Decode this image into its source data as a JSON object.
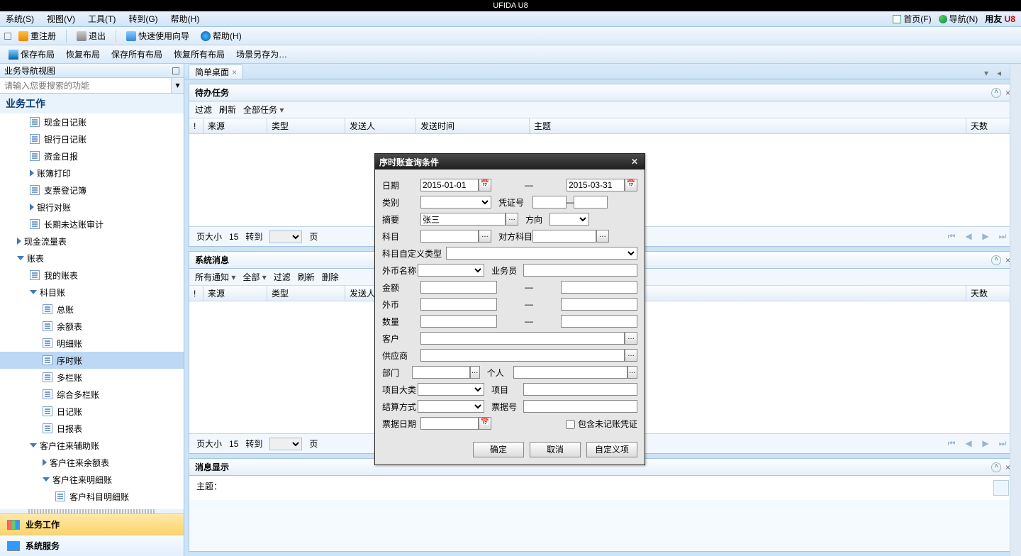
{
  "titlebar": "UFIDA U8",
  "menubar": {
    "items": [
      "系统(S)",
      "视图(V)",
      "工具(T)",
      "转到(G)",
      "帮助(H)"
    ],
    "right": {
      "home": "首页(F)",
      "nav": "导航(N)",
      "brand": "用友",
      "sub": "U8"
    }
  },
  "toolbar1": {
    "register": "重注册",
    "exit": "退出",
    "wizard": "快速使用向导",
    "help": "帮助(H)"
  },
  "toolbar2": {
    "saveLayout": "保存布局",
    "restoreLayout": "恢复布局",
    "saveAll": "保存所有布局",
    "restoreAll": "恢复所有布局",
    "saveScene": "场景另存为…"
  },
  "sidebar": {
    "headTitle": "业务导航视图",
    "searchPlaceholder": "请输入您要搜索的功能",
    "sectionTitle": "业务工作",
    "tree": [
      {
        "lvl": 2,
        "icon": "doc",
        "label": "现金日记账"
      },
      {
        "lvl": 2,
        "icon": "doc",
        "label": "银行日记账"
      },
      {
        "lvl": 2,
        "icon": "doc",
        "label": "资金日报"
      },
      {
        "lvl": 2,
        "icon": "tri-right",
        "label": "账簿打印"
      },
      {
        "lvl": 2,
        "icon": "doc",
        "label": "支票登记簿"
      },
      {
        "lvl": 2,
        "icon": "tri-right",
        "label": "银行对账"
      },
      {
        "lvl": 2,
        "icon": "doc",
        "label": "长期未达账审计"
      },
      {
        "lvl": 1,
        "icon": "tri-right",
        "label": "现金流量表"
      },
      {
        "lvl": 1,
        "icon": "tri-down",
        "label": "账表"
      },
      {
        "lvl": 2,
        "icon": "doc",
        "label": "我的账表"
      },
      {
        "lvl": 2,
        "icon": "tri-down",
        "label": "科目账"
      },
      {
        "lvl": 3,
        "icon": "doc",
        "label": "总账"
      },
      {
        "lvl": 3,
        "icon": "doc",
        "label": "余额表"
      },
      {
        "lvl": 3,
        "icon": "doc",
        "label": "明细账"
      },
      {
        "lvl": 3,
        "icon": "doc",
        "label": "序时账",
        "selected": true
      },
      {
        "lvl": 3,
        "icon": "doc",
        "label": "多栏账"
      },
      {
        "lvl": 3,
        "icon": "doc",
        "label": "综合多栏账"
      },
      {
        "lvl": 3,
        "icon": "doc",
        "label": "日记账"
      },
      {
        "lvl": 3,
        "icon": "doc",
        "label": "日报表"
      },
      {
        "lvl": 2,
        "icon": "tri-down",
        "label": "客户往来辅助账"
      },
      {
        "lvl": 3,
        "icon": "tri-right",
        "label": "客户往来余额表"
      },
      {
        "lvl": 3,
        "icon": "tri-down",
        "label": "客户往来明细账"
      },
      {
        "lvl": 4,
        "icon": "doc",
        "label": "客户科目明细账"
      }
    ],
    "bottom": {
      "biz": "业务工作",
      "sys": "系统服务"
    }
  },
  "tabs": {
    "main": "简单桌面"
  },
  "panelTasks": {
    "title": "待办任务",
    "sub": {
      "filter": "过滤",
      "refresh": "刷新",
      "all": "全部任务"
    },
    "cols": {
      "bang": "!",
      "src": "来源",
      "type": "类型",
      "sender": "发送人",
      "time": "发送时间",
      "subject": "主题",
      "days": "天数"
    },
    "pager": {
      "sizeLabel": "页大小",
      "sizeVal": "15",
      "gotoLabel": "转到",
      "pageLabel": "页"
    }
  },
  "panelMsg": {
    "title": "系统消息",
    "sub": {
      "notice": "所有通知",
      "all": "全部",
      "filter": "过滤",
      "refresh": "刷新",
      "delete": "删除"
    },
    "cols": {
      "bang": "!",
      "src": "来源",
      "type": "类型",
      "sender": "发送人",
      "days": "天数"
    },
    "pager": {
      "sizeLabel": "页大小",
      "sizeVal": "15",
      "gotoLabel": "转到",
      "pageLabel": "页"
    }
  },
  "panelShow": {
    "title": "消息显示",
    "subject": "主题："
  },
  "dialog": {
    "title": "序时账查询条件",
    "labels": {
      "date": "日期",
      "type": "类别",
      "voucherNo": "凭证号",
      "summary": "摘要",
      "direction": "方向",
      "subject": "科目",
      "oppSubject": "对方科目",
      "subjectCustomType": "科目自定义类型",
      "fcName": "外币名称",
      "salesman": "业务员",
      "amount": "金额",
      "fc": "外币",
      "qty": "数量",
      "customer": "客户",
      "supplier": "供应商",
      "dept": "部门",
      "person": "个人",
      "projCat": "项目大类",
      "project": "项目",
      "settle": "结算方式",
      "billNo": "票据号",
      "billDate": "票据日期",
      "includeUnposted": "包含未记账凭证"
    },
    "values": {
      "dateFrom": "2015-01-01",
      "dateTo": "2015-03-31",
      "summary": "张三"
    },
    "btns": {
      "ok": "确定",
      "cancel": "取消",
      "custom": "自定义项"
    },
    "sep": "—"
  }
}
